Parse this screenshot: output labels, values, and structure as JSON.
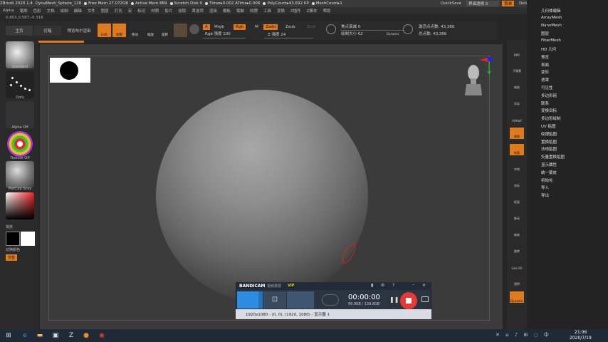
{
  "titlebar": {
    "items": [
      "ZBrush 2020.1.4",
      "DynaMesh_Sphere_128",
      "Free Mem 27.072GB",
      "Active Mem 889",
      "Scratch Disk 0",
      "Timer▸0.002 ATime▸0.006",
      "PolyCount▸43.692 KP",
      "MeshCount▸1"
    ],
    "quicksave": "QuickSave",
    "transparency": "界面透明 0",
    "menus_btn": "菜单",
    "script": "DefaultZScript"
  },
  "menubar": [
    "Alpha",
    "笔刷",
    "色彩",
    "文档",
    "绘制",
    "编辑",
    "文件",
    "图层",
    "灯光",
    "宏",
    "标记",
    "材质",
    "影片",
    "拾取",
    "首选项",
    "渲染",
    "模板",
    "笔触",
    "纹理",
    "工具",
    "变换",
    "Z插件",
    "Z脚本",
    "帮助"
  ],
  "coords": "0.801,0.587,-0.316",
  "toolbar": {
    "home": "主页",
    "lightbox": "灯箱",
    "preview_render": "预览布尔渲染",
    "edit": "Edit",
    "draw": "绘制",
    "move": "移动",
    "scale": "缩放",
    "rotate": "旋转",
    "a_chip": "A",
    "mrgb": "Mrgb",
    "rgb": "Rgb",
    "m": "M",
    "zadd": "Zadd",
    "zsub": "Zsub",
    "zcut": "Zcut",
    "rgb_intensity": "Rgb 强度 100",
    "z_intensity": "Z 强度 24",
    "focal_shift": "焦点衰减 0",
    "draw_size": "绘制大小 62",
    "dynamic": "Dynamic",
    "active_points": "激活点点数: 43,366",
    "total_points": "总点数: 43,366"
  },
  "leftpanel": {
    "brush": "Standard",
    "stroke": "Dots",
    "alpha": "Alpha Off",
    "texture": "Texture Off",
    "material": "MatCap Gray",
    "gradient": "渐变",
    "swap_color": "切换颜色",
    "alternate": "交替"
  },
  "rightstrip": [
    "BPR",
    "子像素",
    "缩放",
    "实际",
    "AAHalf",
    "透视",
    "地面",
    "本地",
    "坐标",
    "框架",
    "移动",
    "缩放",
    "旋转",
    "Line Fill",
    "透明",
    "Dynamic"
  ],
  "rightmenu": [
    "几何体编辑",
    "ArrayMesh",
    "NanoMesh",
    "图层",
    "FiberMesh",
    "HD 几何",
    "预览",
    "表面",
    "变形",
    "遮罩",
    "可见性",
    "多边形组",
    "联系",
    "变换目标",
    "多边形绘制",
    "UV 贴图",
    "纹理贴图",
    "置换贴图",
    "法线贴图",
    "矢量置换贴图",
    "显示属性",
    "统一蒙皮",
    "初始化",
    "导入",
    "导出"
  ],
  "bandicam": {
    "logo": "BANDICAM",
    "tag": "视频录屏",
    "vip": "VIP",
    "timer": "00:00:00",
    "size": "99.0KB / 139.8GB",
    "area": "1920x1080 - (0, 0), (1920, 1080) - 显示器 1"
  },
  "taskbar": {
    "time": "21:06",
    "date": "2020/7/19"
  },
  "colors": {
    "accent": "#e07a1e",
    "record": "#e53a35"
  }
}
